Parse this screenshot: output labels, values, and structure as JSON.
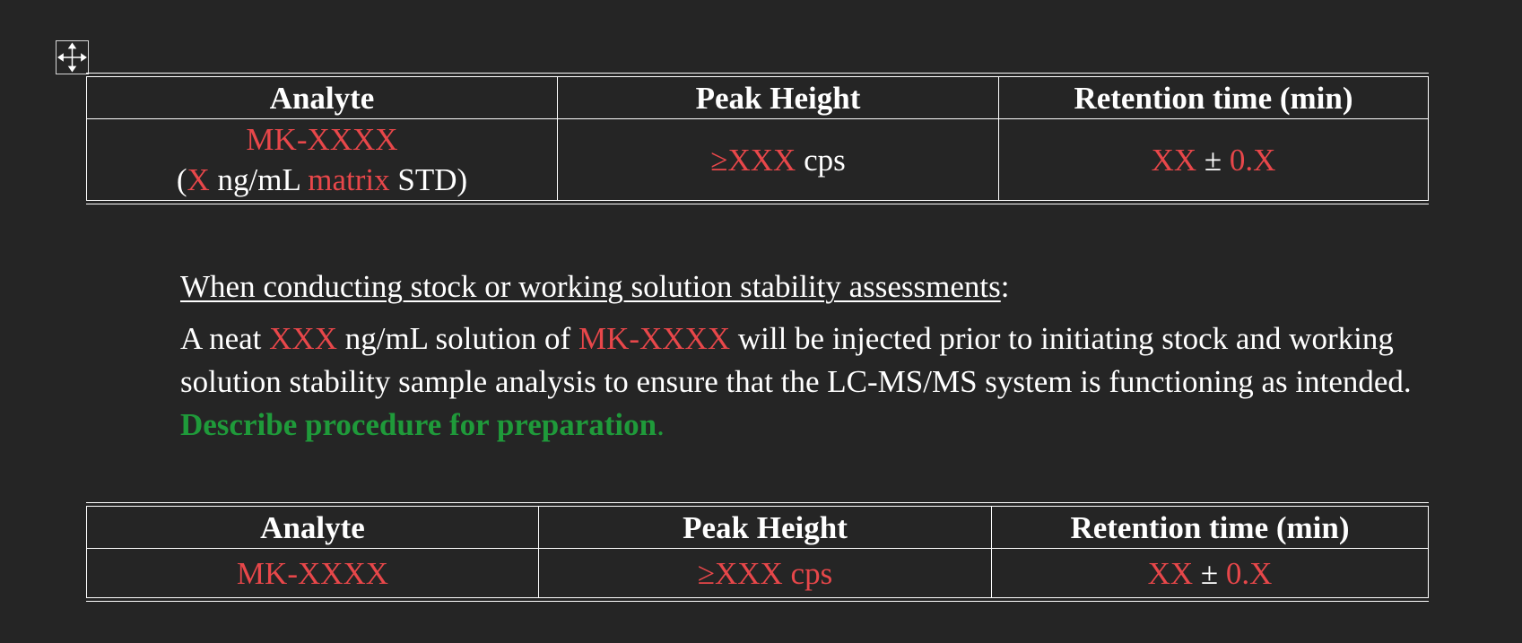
{
  "colors": {
    "background": "#252525",
    "text": "#ffffff",
    "placeholder_red": "#e8474a",
    "instruction_green": "#1f9a3a"
  },
  "icons": {
    "table_move_handle": "four-way-arrow-move-icon"
  },
  "table1": {
    "headers": [
      "Analyte",
      "Peak Height",
      "Retention time (min)"
    ],
    "row": {
      "analyte_line1": "MK-XXXX",
      "analyte_line2": {
        "open_paren": "(",
        "conc": "X",
        "unit": " ng/mL ",
        "matrix": "matrix",
        "std": " STD)"
      },
      "peak_height": {
        "value": "≥XXX",
        "unit": " cps"
      },
      "retention": {
        "value": "XX",
        "pm": " ± ",
        "tol": "0.X"
      }
    }
  },
  "section": {
    "heading": "When conducting stock or working solution stability assessments",
    "heading_colon": ":",
    "para": {
      "p1": "A neat ",
      "conc": "XXX",
      "p2": " ng/mL solution of ",
      "analyte": "MK-XXXX",
      "p3": " will be injected prior to initiating stock and working solution stability sample analysis to ensure that the LC-MS/MS system is functioning as intended. ",
      "instruction": "Describe procedure for preparation",
      "instruction_period": "."
    }
  },
  "table2": {
    "headers": [
      "Analyte",
      "Peak Height",
      "Retention time (min)"
    ],
    "row": {
      "analyte": "MK-XXXX",
      "peak_height": "≥XXX cps",
      "retention": {
        "value": "XX",
        "pm": " ± ",
        "tol": "0.X"
      }
    }
  }
}
